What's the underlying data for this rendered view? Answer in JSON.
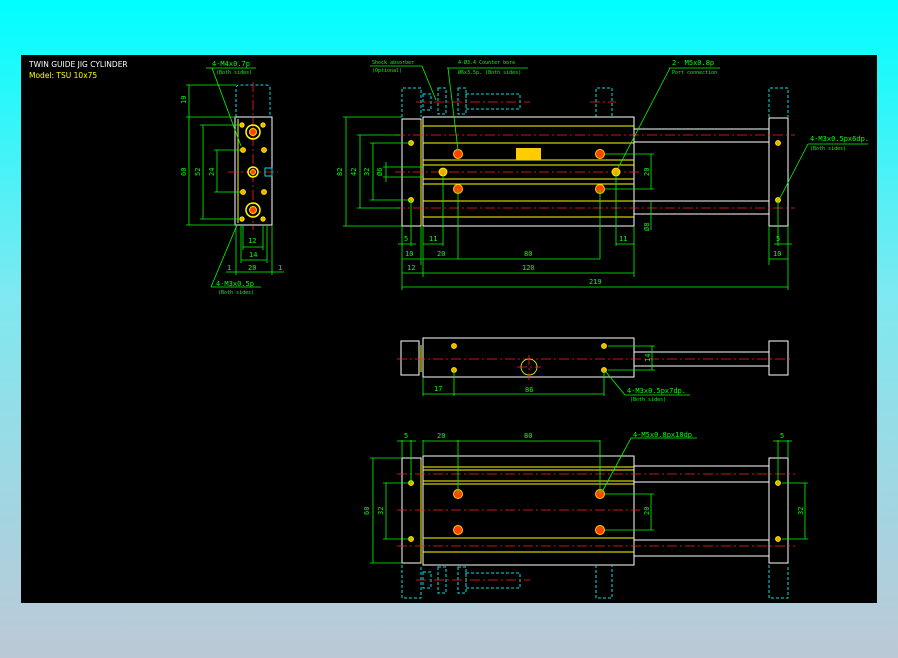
{
  "title": "TWIN GUIDE JIG CYLINDER",
  "model": "Model: TSU 10x75",
  "colors": {
    "background_panel": "#000000",
    "outline": "#ffffff",
    "dimension": "#00ff00",
    "centerline": "#ff2020",
    "hidden": "#00e0e0",
    "hole": "#ffaa00"
  },
  "side_view": {
    "callout_top": "4-M4x0.7p",
    "callout_top_sub": "(Both sides)",
    "callout_bottom": "4-M3x0.5p",
    "callout_bottom_sub": "(Both sides)",
    "dims": [
      "19",
      "60",
      "52",
      "24",
      "12",
      "14",
      "20",
      "1",
      "1"
    ]
  },
  "front_view": {
    "shock_label": "Shock absorber",
    "shock_sub": "(Optional)",
    "counter_label": "4-Ø3.4 Counter bore",
    "counter_sub": "Ø6x3.5p. (Both sides)",
    "port_label": "2- M5x0.8p",
    "port_sub": "Port connection",
    "end_label": "4-M3x0.5px6dp.",
    "end_sub": "(Both sides)",
    "dims": [
      "82",
      "42",
      "32",
      "Ø6",
      "20",
      "Ø8",
      "5",
      "11",
      "11",
      "5",
      "10",
      "20",
      "80",
      "10",
      "12",
      "120",
      "219"
    ]
  },
  "middle_view": {
    "callout": "4-M3x0.5px7dp.",
    "callout_sub": "(Both sides)",
    "dims": [
      "14",
      "17",
      "86"
    ]
  },
  "bottom_view": {
    "callout": "4-M5x0.8px10dp",
    "dims": [
      "5",
      "20",
      "80",
      "5",
      "60",
      "32",
      "20",
      "32"
    ]
  }
}
